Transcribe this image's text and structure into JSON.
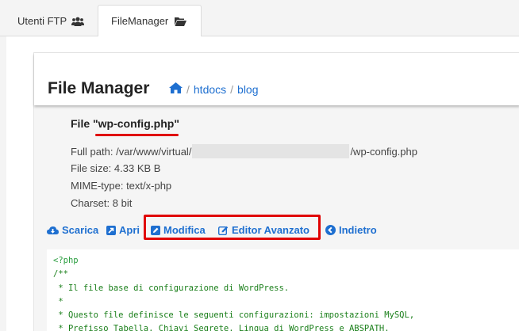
{
  "tabs": [
    {
      "label": "Utenti FTP",
      "icon": "users-icon"
    },
    {
      "label": "FileManager",
      "icon": "folder-open-icon",
      "active": true
    }
  ],
  "header": {
    "title": "File Manager",
    "breadcrumb": {
      "home_icon": "home-icon",
      "items": [
        "htdocs",
        "blog"
      ]
    }
  },
  "file": {
    "heading_prefix": "File \"",
    "name": "wp-config.php",
    "heading_suffix": "\"",
    "path_prefix": "Full path: /var/www/virtual/",
    "path_suffix": "/wp-config.php",
    "size": "File size: 4.33 KB B",
    "mime": "MIME-type: text/x-php",
    "charset": "Charset: 8 bit"
  },
  "actions": {
    "scarica": "Scarica",
    "apri": "Apri",
    "modifica": "Modifica",
    "editor": "Editor Avanzato",
    "indietro": "Indietro"
  },
  "code_lines": [
    "<?php",
    "/**",
    " * Il file base di configurazione di WordPress.",
    " *",
    " * Questo file definisce le seguenti configurazioni: impostazioni MySQL,",
    " * Prefisso Tabella, Chiavi Segrete, Lingua di WordPress e ABSPATH."
  ],
  "colors": {
    "link": "#1e6fd0",
    "highlight": "#e00000",
    "code": "#1a7f1a"
  }
}
